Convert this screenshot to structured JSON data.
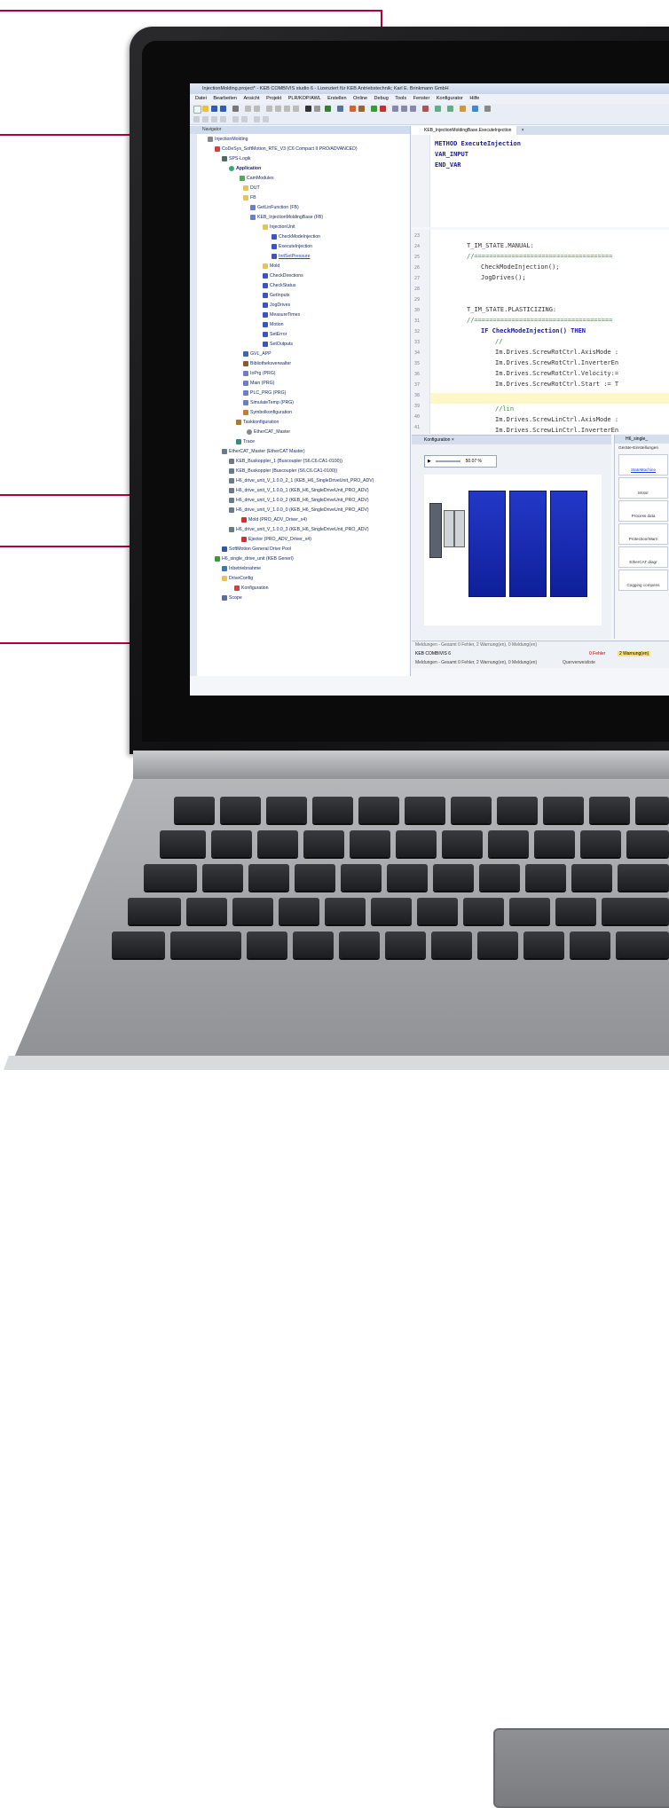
{
  "window": {
    "title": "InjectionMolding.project* - KEB COMBIVIS studio 6 - Lizenziert für KEB Antriebstechnik; Karl E. Brinkmann GmbH"
  },
  "menu": [
    "Datei",
    "Bearbeiten",
    "Ansicht",
    "Projekt",
    "PLR/KOP/AWL",
    "Erstellen",
    "Online",
    "Debug",
    "Tools",
    "Fenster",
    "Konfigurator",
    "Hilfe"
  ],
  "navigator": {
    "header": "Navigator",
    "side_tab": "Gerätekonfiguration",
    "items": [
      "InjectionMolding",
      "CoDeSys_SoftMotion_RTE_V3 (C6 Compact II PRO/ADVANCED)",
      "SPS-Logik",
      "Application",
      "CamModules",
      "DUT",
      "FB",
      "GetLinFunction (FB)",
      "KEB_InjectionMoldingBase (FB)",
      "InjectionUnit",
      "CheckModeInjection",
      "ExecuteInjection",
      "InitSetPressure",
      "Mold",
      "CheckDirections",
      "CheckStatus",
      "GetInputs",
      "JogDrives",
      "MeasureTimes",
      "Motion",
      "SetError",
      "SetOutputs",
      "GVL_APP",
      "Bibliotheksverwalter",
      "IoPrg (PRG)",
      "Main (PRG)",
      "PLC_PRG (PRG)",
      "SimulateTemp (PRG)",
      "Symbolkonfiguration",
      "Taskkonfiguration",
      "EtherCAT_Master",
      "Trace",
      "EtherCAT_Master (EtherCAT Master)",
      "KEB_Buskoppler_1 (Buscoupler (S6.C6.CA1-0100))",
      "KEB_Buskoppler (Buscoupler (S6.C6.CA1-0100))",
      "H6_drive_unit_V_1.0.0_2_1 (KEB_H6_SingleDriveUnit_PRO_ADV)",
      "H6_drive_unit_V_1.0.0_1 (KEB_H6_SingleDriveUnit_PRO_ADV)",
      "H6_drive_unit_V_1.0.0_2 (KEB_H6_SingleDriveUnit_PRO_ADV)",
      "H6_drive_unit_V_1.0.0_0 (KEB_H6_SingleDriveUnit_PRO_ADV)",
      "Mold (PRO_ADV_Driver_x4)",
      "H6_drive_unit_V_1.0.0_3 (KEB_H6_SingleDriveUnit_PRO_ADV)",
      "Ejector (PRO_ADV_Driver_x4)",
      "SoftMotion General Drive Pool",
      "H6_single_drive_unit (KEB Generl)",
      "Inbetriebnahme",
      "DriveConfig",
      "Konfiguration",
      "Scope"
    ]
  },
  "editor": {
    "tab": "KEB_InjectionMoldingBase.ExecuteInjection",
    "decl_lines": [
      "METHOD ExecuteInjection",
      "VAR_INPUT",
      "END_VAR"
    ],
    "line_numbers": [
      "23",
      "24",
      "25",
      "26",
      "27",
      "28",
      "29",
      "30",
      "31",
      "32",
      "33",
      "34",
      "35",
      "36",
      "37",
      "38",
      "39",
      "40",
      "41"
    ],
    "code_lines": [
      "T_IM_STATE.MANUAL:",
      "//=====================================",
      "CheckModeInjection();",
      "JogDrives();",
      "T_IM_STATE.PLASTICIZING:",
      "//=====================================",
      "IF CheckModeInjection() THEN",
      "//",
      "Im.Drives.ScrewRotCtrl.AxisMode :",
      "Im.Drives.ScrewRotCtrl.InverterEn",
      "Im.Drives.ScrewRotCtrl.Velocity:=",
      "Im.Drives.ScrewRotCtrl.Start := T",
      "//lin",
      "Im.Drives.ScrewLinCtrl.AxisMode :",
      "Im.Drives.ScrewLinCtrl.InverterEn"
    ]
  },
  "configuration": {
    "tab": "Konfiguration",
    "zoom": "50.07 %",
    "side_tab": "H6_single_",
    "side_header": "Geräte-Einstellungen",
    "buttons": [
      "StateMachine",
      "Motor",
      "Process data",
      "Protection/Warn",
      "EtherCAT diagr",
      "Cogging compens"
    ]
  },
  "status": {
    "messages_header": "Meldungen - Gesamt 0 Fehler, 2 Warnung(en), 0 Meldung(en)",
    "source": "KEB COMBIVIS 6",
    "errors": "0 Fehler",
    "warnings": "2 Warnung(en)",
    "bottom": "Meldungen - Gesamt 0 Fehler, 2 Warnung(en), 0 Meldung(en)",
    "cross_ref": "Querverweisliste"
  },
  "colors": {
    "callout": "#b3003c",
    "keyword": "#1a1aa0",
    "drive_blue": "#1a2fc0"
  }
}
